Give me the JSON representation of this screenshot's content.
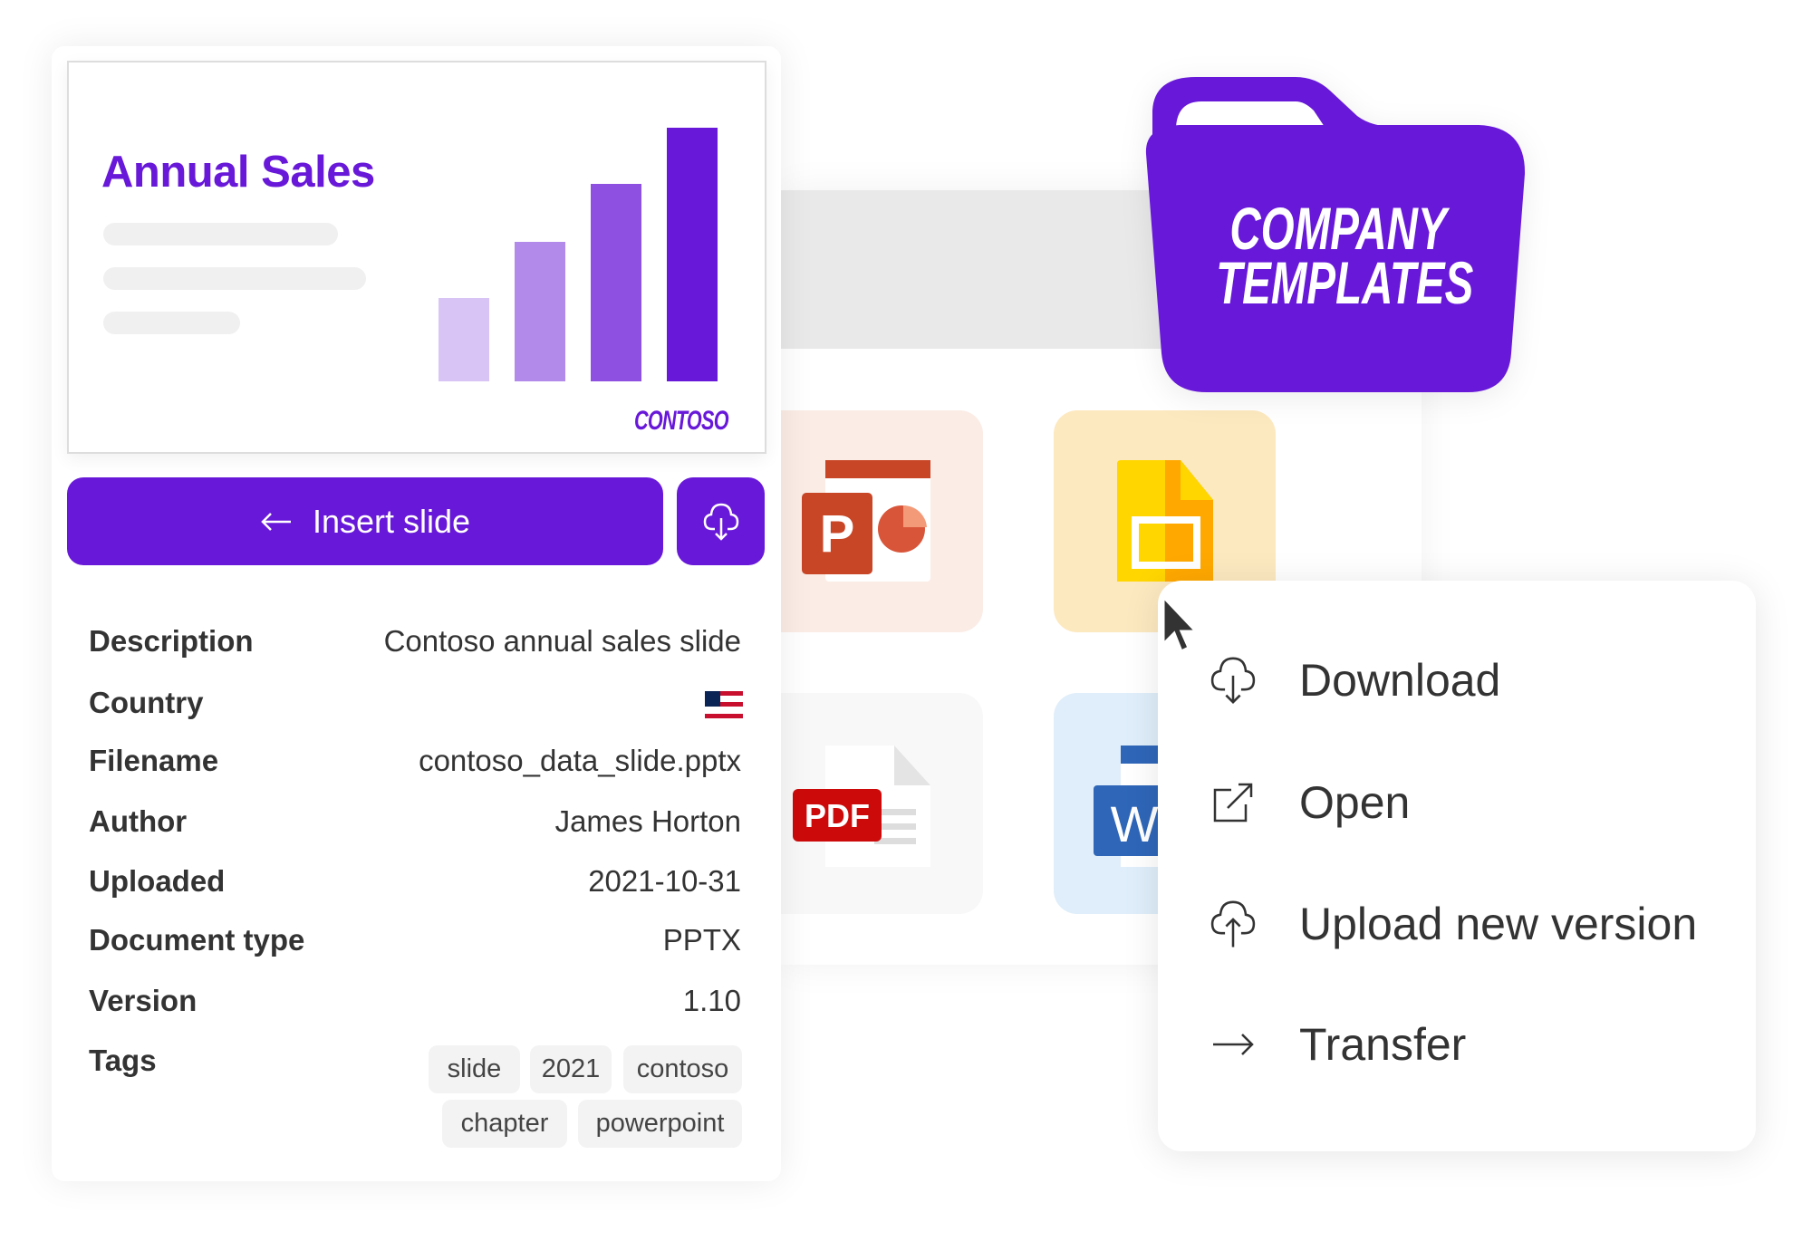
{
  "slide_preview": {
    "title": "Annual Sales",
    "logo_text": "CONTOSO",
    "bar_levels": [
      0.33,
      0.55,
      0.78,
      1.0
    ],
    "bar_colors": [
      "#d9c5f5",
      "#b28ae9",
      "#8d50e0",
      "#6818d8"
    ]
  },
  "actions": {
    "insert_label": "Insert slide",
    "insert_icon": "arrow-left-icon",
    "download_icon": "cloud-download-icon"
  },
  "details": {
    "description": {
      "label": "Description",
      "value": "Contoso annual sales slide"
    },
    "country": {
      "label": "Country",
      "value_icon": "us-flag-icon"
    },
    "filename": {
      "label": "Filename",
      "value": "contoso_data_slide.pptx"
    },
    "author": {
      "label": "Author",
      "value": "James Horton"
    },
    "uploaded": {
      "label": "Uploaded",
      "value": "2021-10-31"
    },
    "doctype": {
      "label": "Document type",
      "value": "PPTX"
    },
    "version": {
      "label": "Version",
      "value": "1.10"
    },
    "tags": {
      "label": "Tags",
      "items": [
        "slide",
        "2021",
        "contoso",
        "chapter",
        "powerpoint"
      ]
    }
  },
  "files": {
    "pdf_label": "PDF",
    "ppt_letter": "P",
    "word_letter": "W"
  },
  "folder": {
    "line1": "COMPANY",
    "line2": "TEMPLATES"
  },
  "context_menu": {
    "items": [
      {
        "label": "Download",
        "icon": "cloud-download-icon"
      },
      {
        "label": "Open",
        "icon": "external-link-icon"
      },
      {
        "label": "Upload new version",
        "icon": "cloud-upload-icon"
      },
      {
        "label": "Transfer",
        "icon": "arrow-right-icon"
      }
    ]
  },
  "colors": {
    "brand": "#6818d8",
    "text": "#333333"
  }
}
